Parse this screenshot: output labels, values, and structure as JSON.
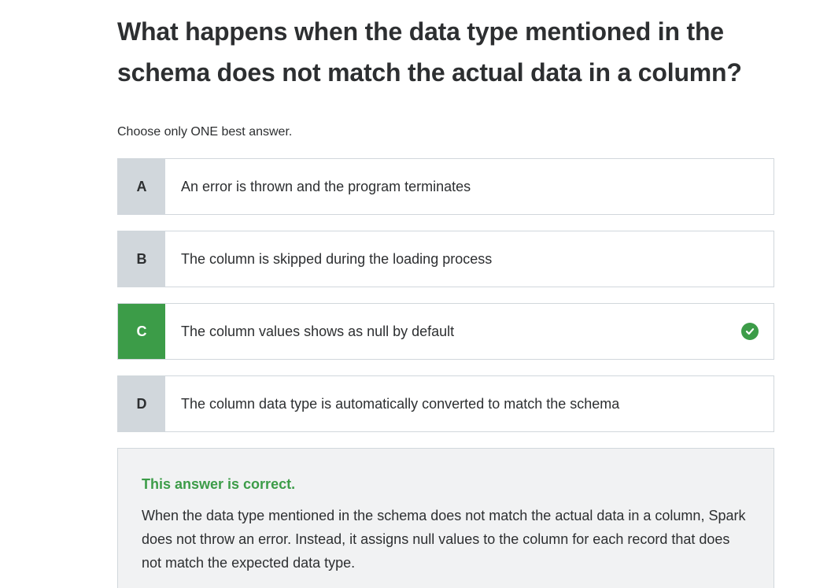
{
  "question": {
    "title": "What happens when the data type mentioned in the schema does not match the actual data in a column?",
    "instruction": "Choose only ONE best answer."
  },
  "options": [
    {
      "letter": "A",
      "text": "An error is thrown and the program terminates",
      "correct": false
    },
    {
      "letter": "B",
      "text": "The column is skipped during the loading process",
      "correct": false
    },
    {
      "letter": "C",
      "text": "The column values shows as null by default",
      "correct": true
    },
    {
      "letter": "D",
      "text": "The column data type is automatically converted to match the schema",
      "correct": false
    }
  ],
  "feedback": {
    "title": "This answer is correct.",
    "body": "When the data type mentioned in the schema does not match the actual data in a column, Spark does not throw an error. Instead, it assigns null values to the column for each record that does not match the expected data type."
  },
  "icons": {
    "correct": "check-circle-icon"
  },
  "colors": {
    "correct_green": "#3c9c48",
    "letter_bg": "#d1d7dc",
    "feedback_bg": "#f1f2f3",
    "text": "#2d2f31"
  }
}
